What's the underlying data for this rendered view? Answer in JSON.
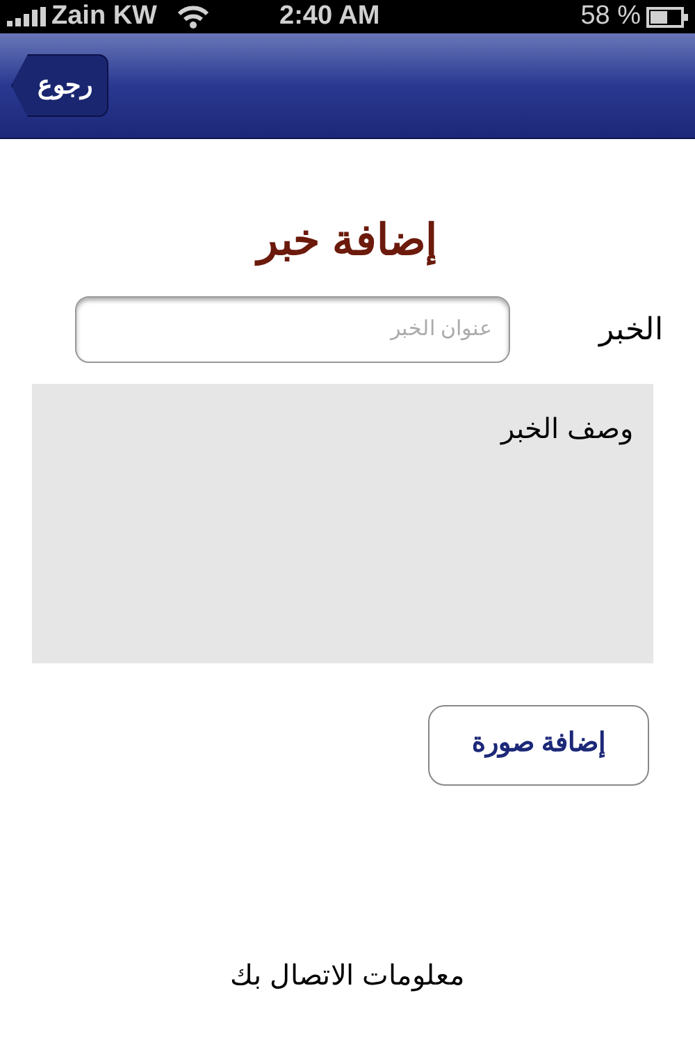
{
  "status_bar": {
    "carrier": "Zain KW",
    "time": "2:40 AM",
    "battery": "58 %"
  },
  "nav_bar": {
    "back_button": "رجوع"
  },
  "title": "إضافة خبر",
  "headline": {
    "label": "الخبر",
    "placeholder": "عنوان الخبر"
  },
  "description": {
    "value": "وصف الخبر"
  },
  "add_image_button": "إضافة صورة",
  "footer": "معلومات الاتصال بك"
}
